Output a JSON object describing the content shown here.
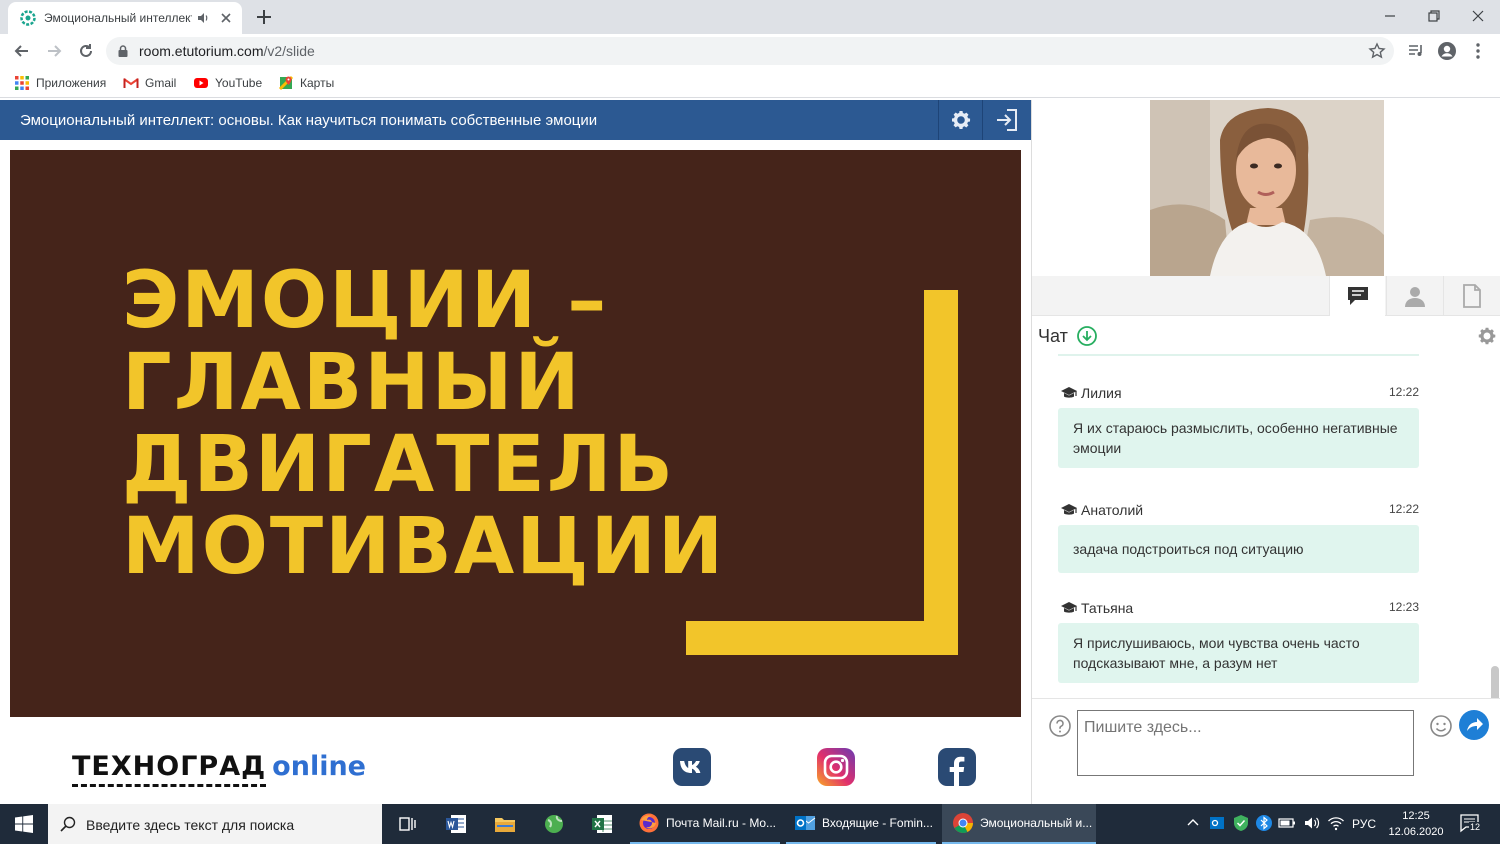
{
  "browser": {
    "tab_title": "Эмоциональный интеллект",
    "url_host": "room.etutorium.com",
    "url_path": "/v2/slide",
    "bookmarks": [
      "Приложения",
      "Gmail",
      "YouTube",
      "Карты"
    ]
  },
  "lesson": {
    "title": "Эмоциональный интеллект: основы. Как научиться понимать собственные эмоции"
  },
  "slide": {
    "headline": "ЭМОЦИИ –\nГЛАВНЫЙ\nДВИГАТЕЛЬ\nМОТИВАЦИИ",
    "accent_color": "#f2c52a",
    "background_color": "#45241a"
  },
  "footer": {
    "brand_main": "ТЕХНОГРАД",
    "brand_suffix": "online",
    "social_icons": [
      "vk-icon",
      "instagram-icon",
      "facebook-icon"
    ]
  },
  "chat": {
    "label": "Чат",
    "messages": [
      {
        "author": "Лилия",
        "time": "12:22",
        "text": "Я их стараюсь размыслить, особенно негативные эмоции"
      },
      {
        "author": "Анатолий",
        "time": "12:22",
        "text": "задача подстроиться под ситуацию"
      },
      {
        "author": "Татьяна",
        "time": "12:23",
        "text": "Я прислушиваюсь, мои чувства очень часто подсказывают мне, а разум нет"
      }
    ],
    "input_placeholder": "Пишите здесь..."
  },
  "taskbar": {
    "search_placeholder": "Введите здесь текст для поиска",
    "apps": [
      {
        "label": "Почта Mail.ru - Mo..."
      },
      {
        "label": "Входящие - Fomin..."
      },
      {
        "label": "Эмоциональный и..."
      }
    ],
    "language": "РУС",
    "time": "12:25",
    "date": "12.06.2020",
    "notification_count": "12"
  },
  "colors": {
    "header_blue": "#2c5992",
    "chat_bubble": "#e0f5ee",
    "send_blue": "#1e7fd6"
  }
}
